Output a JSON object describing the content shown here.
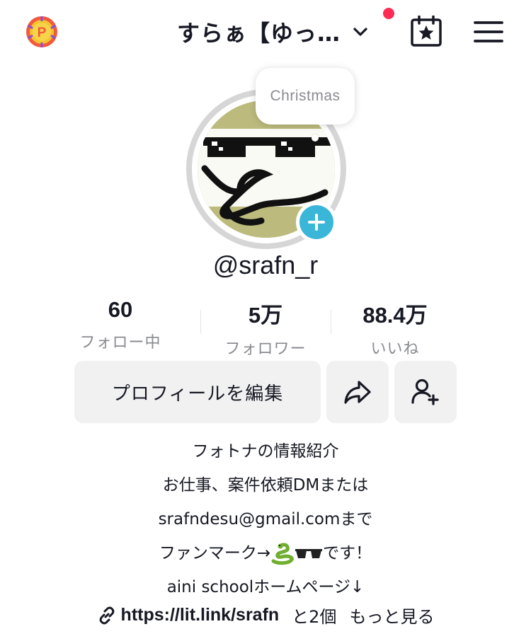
{
  "header": {
    "username": "すらぁ【ゆっ…",
    "has_notification_dot": true,
    "colors": {
      "dot": "#fe2c55",
      "coin": "#f4c430"
    },
    "icons": {
      "coin": "points-coin-icon",
      "dropdown": "chevron-down-icon",
      "calendar": "calendar-star-icon",
      "menu": "hamburger-menu-icon"
    },
    "coin_letter": "P"
  },
  "profile": {
    "bubble_text": "Christmas",
    "handle": "@srafn_r",
    "add_badge_color": "#39b6d8"
  },
  "stats": [
    {
      "value": "60",
      "label": "フォロー中"
    },
    {
      "value": "5万",
      "label": "フォロワー"
    },
    {
      "value": "88.4万",
      "label": "いいね"
    }
  ],
  "actions": {
    "edit_label": "プロフィールを編集",
    "share_icon": "share-arrow-icon",
    "add_friend_icon": "add-friend-icon"
  },
  "bio": {
    "lines": [
      "フォトナの情報紹介",
      "お仕事、案件依頼DMまたは",
      "srafndesu@gmail.comまで",
      "ファンマーク→",
      "aini schoolホームページ↓"
    ],
    "fanmark_suffix": "です！",
    "fanmark_icons": [
      "snake-emoji-icon",
      "sunglasses-emoji-icon"
    ]
  },
  "link": {
    "url": "https://lit.link/srafn",
    "extra": "と2個",
    "more": "もっと見る",
    "icon": "link-icon"
  }
}
